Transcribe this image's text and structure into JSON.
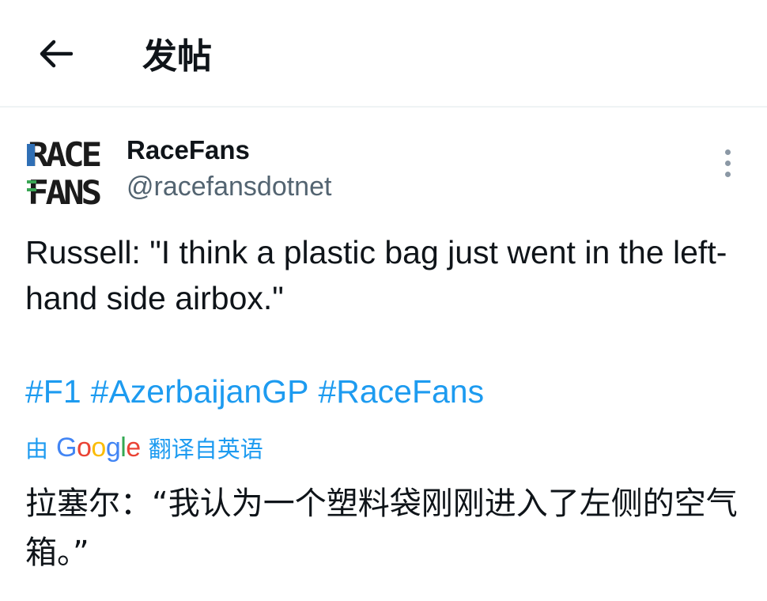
{
  "header": {
    "title": "发帖",
    "back_icon": "arrow-left-icon"
  },
  "tweet": {
    "author": {
      "avatar_text_line1": "RACE",
      "avatar_text_line2": "FANS",
      "display_name": "RaceFans",
      "handle": "@racefansdotnet"
    },
    "more_icon": "more-vertical-icon",
    "text": "Russell: \"I think a plastic bag just went in the left-hand side airbox.\"",
    "hashtags": [
      "#F1",
      "#AzerbaijanGP",
      "#RaceFans"
    ],
    "translation": {
      "prefix": "由",
      "provider": "Google",
      "suffix": "翻译自英语",
      "text": "拉塞尔：“我认为一个塑料袋刚刚进入了左侧的空气箱。”"
    }
  },
  "colors": {
    "link": "#1d9bf0",
    "text": "#0f1419",
    "secondary": "#536471",
    "divider": "#eff3f4",
    "avatar_accent": "#2f6fb5"
  }
}
